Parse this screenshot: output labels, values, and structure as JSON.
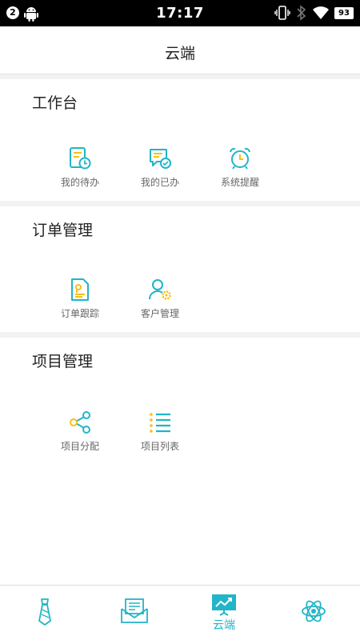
{
  "status_bar": {
    "notification_count": "2",
    "time": "17:17",
    "battery": "93",
    "icons": [
      "android-icon",
      "vibrate-icon",
      "bluetooth-icon",
      "wifi-icon",
      "battery-icon"
    ]
  },
  "header": {
    "title": "云端"
  },
  "sections": [
    {
      "title": "工作台",
      "items": [
        {
          "label": "我的待办",
          "icon": "todo-clock-icon"
        },
        {
          "label": "我的已办",
          "icon": "done-chat-icon"
        },
        {
          "label": "系统提醒",
          "icon": "alarm-clock-icon"
        }
      ]
    },
    {
      "title": "订单管理",
      "items": [
        {
          "label": "订单跟踪",
          "icon": "order-document-icon"
        },
        {
          "label": "客户管理",
          "icon": "customer-gear-icon"
        }
      ]
    },
    {
      "title": "项目管理",
      "items": [
        {
          "label": "项目分配",
          "icon": "share-nodes-icon"
        },
        {
          "label": "项目列表",
          "icon": "list-icon"
        }
      ]
    }
  ],
  "tab_bar": {
    "tabs": [
      {
        "label": "",
        "icon": "tie-icon"
      },
      {
        "label": "",
        "icon": "mail-icon"
      },
      {
        "label": "云端",
        "icon": "presentation-chart-icon",
        "active": true
      },
      {
        "label": "",
        "icon": "atom-icon"
      }
    ]
  },
  "colors": {
    "accent": "#21b5c8",
    "highlight": "#f5c018",
    "text_secondary": "#666666"
  }
}
